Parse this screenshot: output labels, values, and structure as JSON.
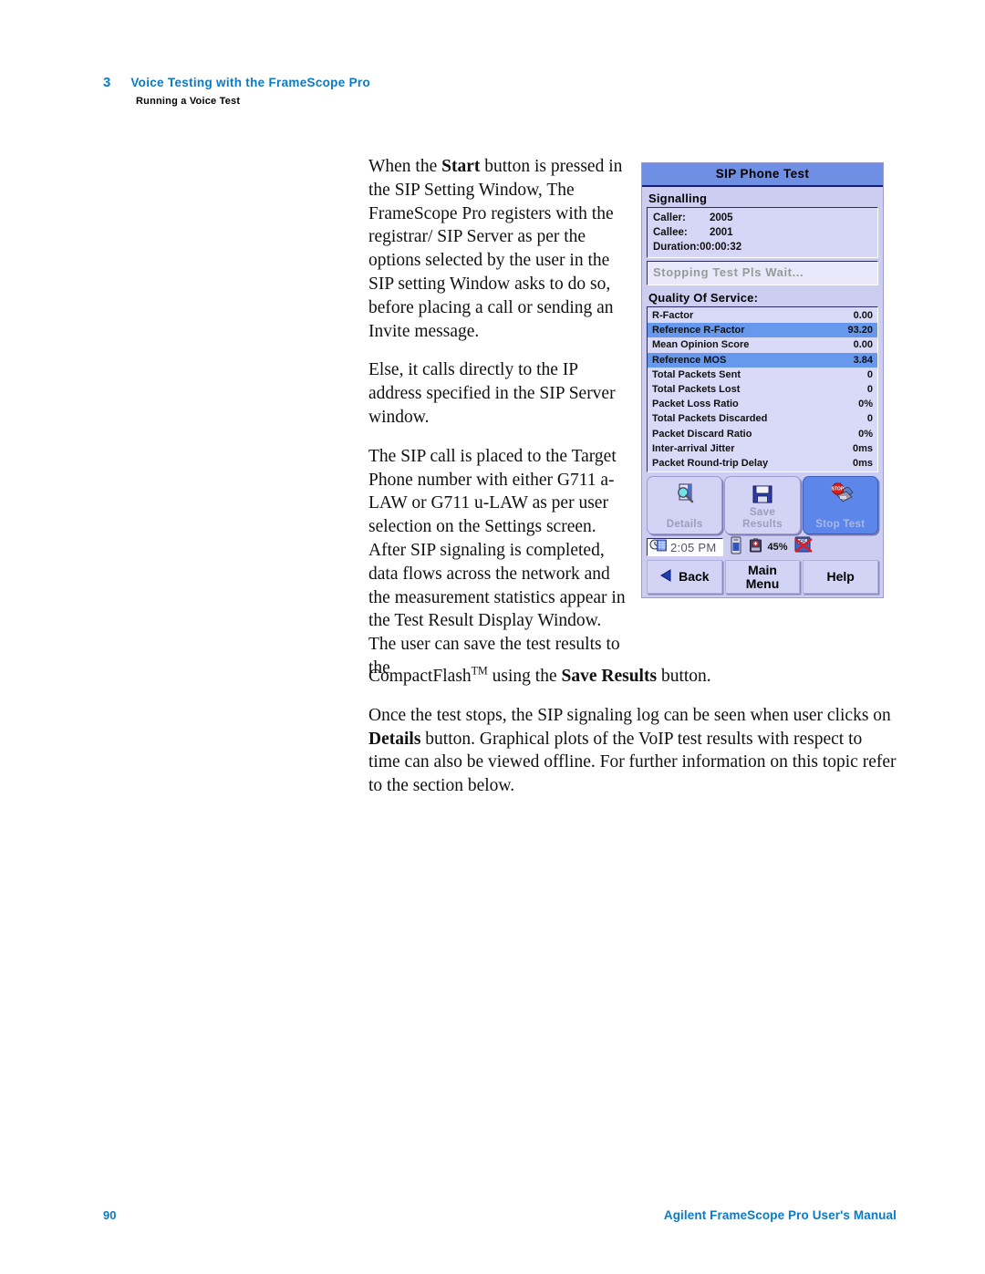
{
  "header": {
    "chapter_number": "3",
    "chapter_title": "Voice Testing with the FrameScope Pro",
    "section_title": "Running a Voice Test"
  },
  "body": {
    "paragraphs": [
      {
        "id": "p1",
        "runs": [
          {
            "t": "When the ",
            "b": false
          },
          {
            "t": "Start",
            "b": true
          },
          {
            "t": " button is pressed in the SIP Setting Window, The FrameScope Pro registers with the registrar/ SIP Server as per the options selected by the user in the SIP setting Window asks to do so, before placing a call or sending an Invite message.",
            "b": false
          }
        ]
      },
      {
        "id": "p2",
        "runs": [
          {
            "t": "Else, it calls directly to the IP address specified in the SIP Server window.",
            "b": false
          }
        ]
      },
      {
        "id": "p3",
        "runs": [
          {
            "t": "The SIP call is placed to the Target Phone number with either G711 a-LAW or G711 u-LAW as per user selection on the Settings screen. After SIP signaling is completed, data flows across the network and the measurement statistics appear in the Test Result Display Window. The user can save the test results to the",
            "b": false
          }
        ]
      }
    ],
    "wide_paragraphs": [
      {
        "id": "p4",
        "runs": [
          {
            "t": "CompactFlash",
            "b": false
          },
          {
            "t": "TM",
            "b": false,
            "sup": true
          },
          {
            "t": " using the ",
            "b": false
          },
          {
            "t": "Save Results",
            "b": true
          },
          {
            "t": " button.",
            "b": false
          }
        ]
      },
      {
        "id": "p5",
        "runs": [
          {
            "t": "Once the test stops, the SIP signaling log can be seen when user clicks on ",
            "b": false
          },
          {
            "t": "Details",
            "b": true
          },
          {
            "t": " button. Graphical plots of the VoIP test results with respect to time can also be viewed offline. For further information on this topic refer to the section below.",
            "b": false
          }
        ]
      }
    ]
  },
  "device": {
    "title": "SIP Phone Test",
    "signalling_label": "Signalling",
    "signalling": [
      {
        "key": "Caller:",
        "value": "2005",
        "spaced": true
      },
      {
        "key": "Callee:",
        "value": "2001",
        "spaced": true
      },
      {
        "key": "Duration:",
        "value": "00:00:32",
        "spaced": false
      }
    ],
    "status_message": "Stopping Test Pls Wait...",
    "qos_label": "Quality Of Service:",
    "qos_rows": [
      {
        "name": "R-Factor",
        "value": "0.00",
        "highlight": false
      },
      {
        "name": "Reference R-Factor",
        "value": "93.20",
        "highlight": true
      },
      {
        "name": "Mean Opinion Score",
        "value": "0.00",
        "highlight": false
      },
      {
        "name": "Reference MOS",
        "value": "3.84",
        "highlight": true
      },
      {
        "name": "Total Packets Sent",
        "value": "0",
        "highlight": false
      },
      {
        "name": "Total Packets Lost",
        "value": "0",
        "highlight": false
      },
      {
        "name": "Packet Loss Ratio",
        "value": "0%",
        "highlight": false
      },
      {
        "name": "Total Packets Discarded",
        "value": "0",
        "highlight": false
      },
      {
        "name": "Packet Discard Ratio",
        "value": "0%",
        "highlight": false
      },
      {
        "name": "Inter-arrival Jitter",
        "value": "0ms",
        "highlight": false
      },
      {
        "name": "Packet Round-trip Delay",
        "value": "0ms",
        "highlight": false
      }
    ],
    "toolbar": [
      {
        "label": "Details",
        "icon": "magnifier-document-icon",
        "active": false
      },
      {
        "label": "Save\nResults",
        "label_l1": "Save",
        "label_l2": "Results",
        "icon": "floppy-disk-icon",
        "active": false
      },
      {
        "label": "Stop Test",
        "icon": "stop-sign-device-icon",
        "active": true
      }
    ],
    "statusbar": {
      "clock_icon": "clock-calendar-icon",
      "time": "2:05 PM",
      "device_icon": "handheld-device-icon",
      "battery_icon": "battery-icon",
      "battery_pct": "45%",
      "cf_icon": "compactflash-absent-icon"
    },
    "nav": [
      {
        "label": "Back",
        "icon": "back-arrow-icon"
      },
      {
        "label_l1": "Main",
        "label_l2": "Menu",
        "icon": null
      },
      {
        "label": "Help",
        "icon": null
      }
    ],
    "colors": {
      "titlebar": "#6e8fe4",
      "panel_bg": "#cdcdf2",
      "highlight": "#6699ee",
      "active_button": "#5d86ea"
    }
  },
  "footer": {
    "page_number": "90",
    "manual_title": "Agilent FrameScope Pro User's Manual"
  }
}
